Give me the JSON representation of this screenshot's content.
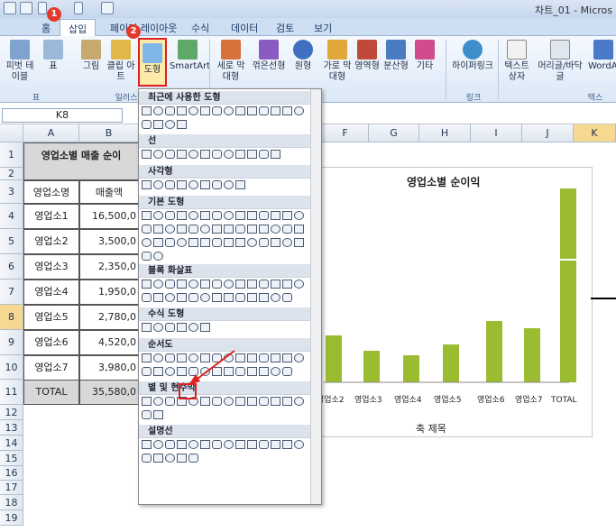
{
  "window": {
    "title": "차트_01 - Micros"
  },
  "quick_access": [
    "save-icon",
    "undo-icon",
    "redo-icon",
    "print-preview-icon"
  ],
  "tabs": [
    "홈",
    "삽입",
    "페이지 레이아웃",
    "수식",
    "데이터",
    "검토",
    "보기"
  ],
  "ribbon": {
    "buttons": {
      "pivot": "피벗 테이블",
      "table": "표",
      "picture": "그림",
      "clipart": "클립 아트",
      "shapes": "도형",
      "smartart": "SmartArt",
      "column": "세로 막대형",
      "line": "꺾은선형",
      "pie": "원형",
      "bar": "가로 막대형",
      "area": "영역형",
      "scatter": "분산형",
      "other": "기타",
      "hyperlink": "하이퍼링크",
      "textbox": "텍스트 상자",
      "header": "머리글/바닥글",
      "wordart": "WordArt"
    },
    "groups": {
      "tables": "표",
      "illust": "일러스",
      "links": "링크",
      "text": "텍스"
    }
  },
  "badges": {
    "one": "1",
    "two": "2"
  },
  "namebox": "K8",
  "columns": [
    "A",
    "B",
    "F",
    "G",
    "H",
    "I",
    "J",
    "K"
  ],
  "rows": [
    "1",
    "2",
    "3",
    "4",
    "5",
    "6",
    "7",
    "8",
    "9",
    "10",
    "11",
    "12",
    "13",
    "14",
    "15",
    "16",
    "17",
    "18",
    "19"
  ],
  "sheet": {
    "title": "영업소별 매출 순이",
    "headers": [
      "영업소명",
      "매출액"
    ],
    "data": [
      [
        "영업소1",
        "16,500,0"
      ],
      [
        "영업소2",
        "3,500,0"
      ],
      [
        "영업소3",
        "2,350,0"
      ],
      [
        "영업소4",
        "1,950,0"
      ],
      [
        "영업소5",
        "2,780,0"
      ],
      [
        "영업소6",
        "4,520,0"
      ],
      [
        "영업소7",
        "3,980,0"
      ],
      [
        "TOTAL",
        "35,580,0"
      ]
    ]
  },
  "chart_data": {
    "type": "bar",
    "title": "영업소별 순이익",
    "xlabel": "축 제목",
    "categories": [
      "영업소2",
      "영업소3",
      "영업소4",
      "영업소5",
      "영업소6",
      "영업소7",
      "TOTAL"
    ],
    "values": [
      52,
      35,
      30,
      42,
      68,
      60,
      135
    ],
    "extra_segment_total": 78,
    "ylim": [
      0,
      215
    ],
    "bar_color": "#9bbb31"
  },
  "shapes_menu": {
    "sections": [
      "최근에 사용한 도형",
      "선",
      "사각형",
      "기본 도형",
      "블록 화살표",
      "수식 도형",
      "순서도",
      "별 및 현수막",
      "설명선"
    ],
    "counts": [
      18,
      12,
      9,
      44,
      27,
      6,
      27,
      16,
      19
    ]
  },
  "colors": {
    "accent": "#e02020",
    "ribbon": "#dce8f6",
    "chart_bar": "#9bbb31",
    "menu_header": "#dde3ec"
  }
}
